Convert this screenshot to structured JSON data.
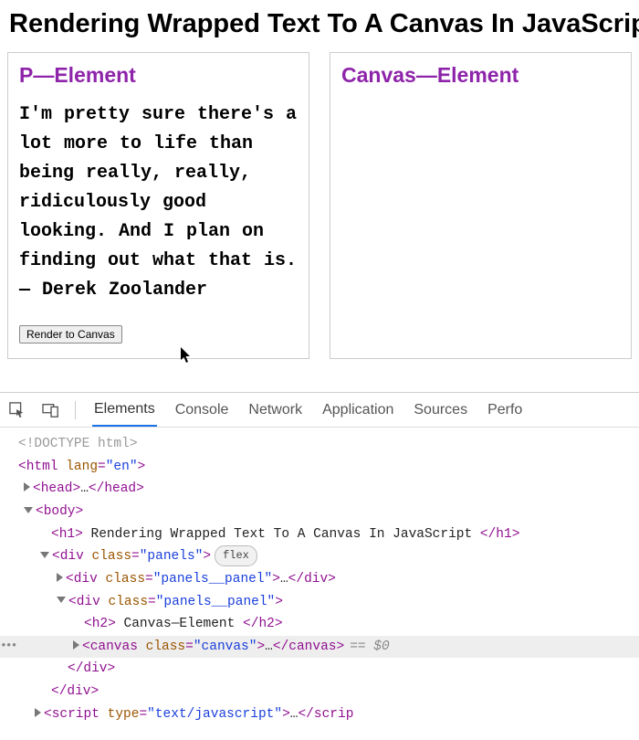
{
  "page": {
    "title": "Rendering Wrapped Text To A Canvas In JavaScript"
  },
  "panel_left": {
    "heading": "P—Element",
    "quote": "I'm pretty sure there's a lot more to life than being really, really, ridiculously good looking. And I plan on finding out what that is. — Derek Zoolander",
    "button_label": "Render to Canvas"
  },
  "panel_right": {
    "heading": "Canvas—Element"
  },
  "devtools": {
    "tabs": {
      "elements": "Elements",
      "console": "Console",
      "network": "Network",
      "application": "Application",
      "sources": "Sources",
      "perf": "Perfo"
    },
    "pill_flex": "flex",
    "selected_suffix": "== $0",
    "dom": {
      "doctype": "<!DOCTYPE html>",
      "html_open": "<html ",
      "lang_attr": "lang",
      "lang_val": "\"en\"",
      "html_open_end": ">",
      "head": "<head>",
      "head_ell": "…",
      "head_close": "</head>",
      "body_open": "<body>",
      "h1_open": "<h1>",
      "h1_text": " Rendering Wrapped Text To A Canvas In JavaScript ",
      "h1_close": "</h1>",
      "div_open": "<div ",
      "class_attr": "class",
      "panels_val": "\"panels\"",
      "panels_panel_val": "\"panels__panel\"",
      "div_open_end": ">",
      "div_ell": "…",
      "div_close": "</div>",
      "h2_open": "<h2>",
      "h2_text": " Canvas—Element ",
      "h2_close": "</h2>",
      "canvas_open": "<canvas ",
      "canvas_val": "\"canvas\"",
      "canvas_open_end": ">",
      "canvas_ell": "…",
      "canvas_close": "</canvas>",
      "script_open": "<script ",
      "type_attr": "type",
      "type_val": "\"text/javascript\"",
      "script_open_end": ">",
      "script_ell": "…",
      "script_close_frag": "</scrip"
    }
  }
}
